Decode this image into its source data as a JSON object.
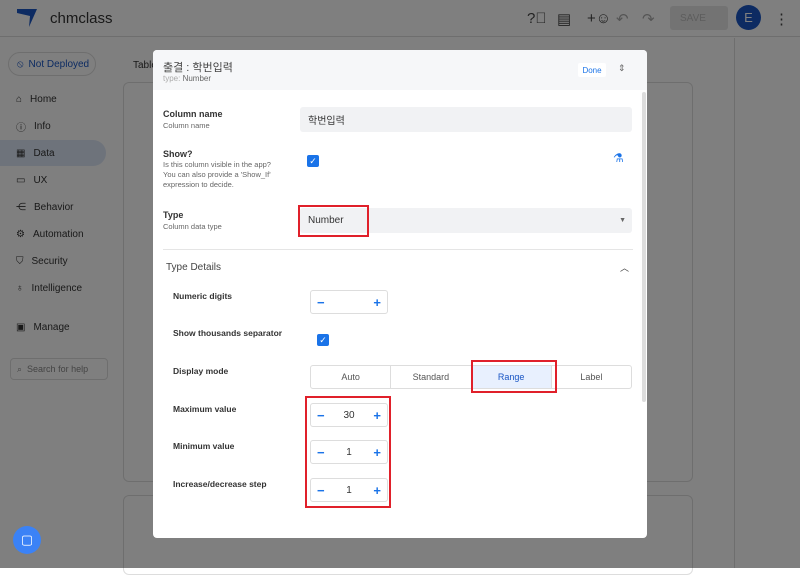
{
  "app": {
    "name": "chmclass",
    "save_label": "SAVE",
    "avatar_letter": "E"
  },
  "sidebar": {
    "deploy_status": "Not Deployed",
    "items": [
      {
        "label": "Home",
        "icon": "home-icon"
      },
      {
        "label": "Info",
        "icon": "info-icon"
      },
      {
        "label": "Data",
        "icon": "data-icon"
      },
      {
        "label": "UX",
        "icon": "ux-icon"
      },
      {
        "label": "Behavior",
        "icon": "behavior-icon"
      },
      {
        "label": "Automation",
        "icon": "automation-icon"
      },
      {
        "label": "Security",
        "icon": "shield-icon"
      },
      {
        "label": "Intelligence",
        "icon": "bulb-icon"
      },
      {
        "label": "Manage",
        "icon": "manage-icon"
      }
    ],
    "search_placeholder": "Search for help"
  },
  "background": {
    "tables_label": "Table"
  },
  "modal": {
    "title": "출결 : 학번입력",
    "type_prefix": "type:",
    "type_value": "Number",
    "done_label": "Done",
    "column_name": {
      "label": "Column name",
      "hint": "Column name",
      "value": "학번입력"
    },
    "show": {
      "label": "Show?",
      "hint": "Is this column visible in the app? You can also provide a 'Show_If' expression to decide.",
      "checked": true
    },
    "type": {
      "label": "Type",
      "hint": "Column data type",
      "value": "Number"
    },
    "type_details": {
      "heading": "Type Details",
      "numeric_digits": {
        "label": "Numeric digits",
        "value": ""
      },
      "thousands": {
        "label": "Show thousands separator",
        "checked": true
      },
      "display_mode": {
        "label": "Display mode",
        "options": [
          "Auto",
          "Standard",
          "Range",
          "Label"
        ],
        "selected": "Range"
      },
      "max": {
        "label": "Maximum value",
        "value": "30"
      },
      "min": {
        "label": "Minimum value",
        "value": "1"
      },
      "step": {
        "label": "Increase/decrease step",
        "value": "1"
      }
    }
  },
  "colors": {
    "accent": "#1a73e8",
    "highlight": "#e0202a"
  }
}
